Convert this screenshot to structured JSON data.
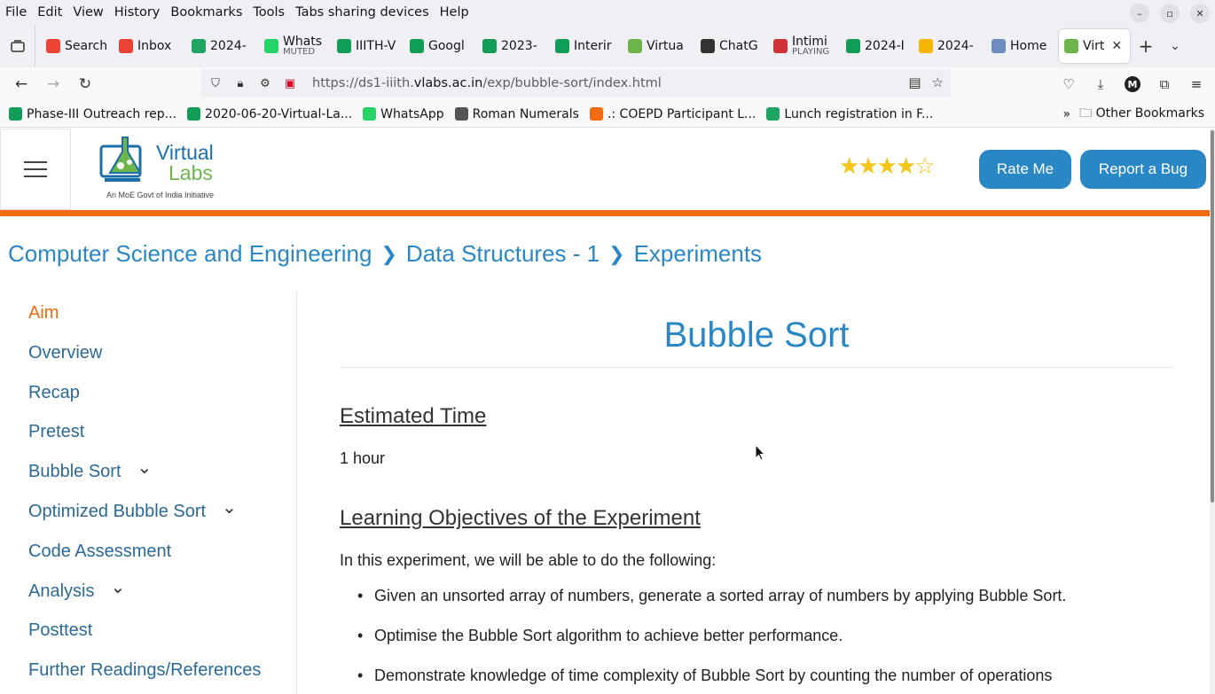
{
  "menubar": {
    "items": [
      "File",
      "Edit",
      "View",
      "History",
      "Bookmarks",
      "Tools",
      "Tabs sharing devices",
      "Help"
    ]
  },
  "tabs": [
    {
      "label": "Search",
      "fav": "gmail-icon",
      "color": "#ea4335"
    },
    {
      "label": "Inbox",
      "fav": "gmail-icon",
      "color": "#ea4335"
    },
    {
      "label": "2024-",
      "fav": "drive-icon",
      "color": "#1fa463"
    },
    {
      "label": "Whats",
      "sub": "MUTED",
      "fav": "whatsapp-icon",
      "color": "#25d366"
    },
    {
      "label": "IIITH-V",
      "fav": "sheets-icon",
      "color": "#0f9d58"
    },
    {
      "label": "Googl",
      "fav": "sheets-icon",
      "color": "#0f9d58"
    },
    {
      "label": "2023-",
      "fav": "sheets-icon",
      "color": "#0f9d58"
    },
    {
      "label": "Interir",
      "fav": "sheets-icon",
      "color": "#0f9d58"
    },
    {
      "label": "Virtua",
      "fav": "vlabs-icon",
      "color": "#6cb64b"
    },
    {
      "label": "ChatG",
      "fav": "chatgpt-icon",
      "color": "#333333"
    },
    {
      "label": "Intimi",
      "sub": "PLAYING",
      "fav": "podcast-icon",
      "color": "#d0323b"
    },
    {
      "label": "2024-I",
      "fav": "sheets-icon",
      "color": "#0f9d58"
    },
    {
      "label": "2024-",
      "fav": "slides-icon",
      "color": "#f4b400"
    },
    {
      "label": "Home",
      "fav": "home-icon",
      "color": "#6c8ebf"
    },
    {
      "label": "Virt",
      "fav": "vlabs-icon",
      "color": "#6cb64b",
      "active": true
    }
  ],
  "urlbar": {
    "prefix": "https://ds1-iiith.",
    "host": "vlabs.ac.in",
    "path": "/exp/bubble-sort/index.html"
  },
  "bookmarks": [
    {
      "label": "Phase-III Outreach rep...",
      "fav": "sheets-icon",
      "color": "#0f9d58"
    },
    {
      "label": "2020-06-20-Virtual-La...",
      "fav": "sheets-icon",
      "color": "#0f9d58"
    },
    {
      "label": "WhatsApp",
      "fav": "whatsapp-icon",
      "color": "#25d366"
    },
    {
      "label": "Roman Numerals",
      "fav": "roman-icon",
      "color": "#555555"
    },
    {
      "label": ".: COEPD Participant L...",
      "fav": "coepd-icon",
      "color": "#f26b0f"
    },
    {
      "label": "Lunch registration in F...",
      "fav": "drive-icon",
      "color": "#1fa463"
    }
  ],
  "bookmarks_other": "Other Bookmarks",
  "site": {
    "logo_line1": "Virtual",
    "logo_line2": "Labs",
    "logo_tagline": "An MoE Govt of India Initiative",
    "rating": 4,
    "rating_max": 5,
    "rate_button": "Rate Me",
    "bug_button": "Report a Bug"
  },
  "breadcrumb": [
    "Computer Science and Engineering",
    "Data Structures - 1",
    "Experiments"
  ],
  "sidebar": [
    {
      "label": "Aim",
      "active": true,
      "expandable": false
    },
    {
      "label": "Overview",
      "expandable": false
    },
    {
      "label": "Recap",
      "expandable": false
    },
    {
      "label": "Pretest",
      "expandable": false
    },
    {
      "label": "Bubble Sort",
      "expandable": true
    },
    {
      "label": "Optimized Bubble Sort",
      "expandable": true
    },
    {
      "label": "Code Assessment",
      "expandable": false
    },
    {
      "label": "Analysis",
      "expandable": true
    },
    {
      "label": "Posttest",
      "expandable": false
    },
    {
      "label": "Further Readings/References",
      "expandable": false
    }
  ],
  "content": {
    "title": "Bubble Sort",
    "section1_heading": "Estimated Time",
    "section1_text": "1 hour",
    "section2_heading": "Learning Objectives of the Experiment",
    "section2_intro": "In this experiment, we will be able to do the following:",
    "objectives": [
      "Given an unsorted array of numbers, generate a sorted array of numbers by applying Bubble Sort.",
      "Optimise the Bubble Sort algorithm to achieve better performance.",
      "Demonstrate knowledge of time complexity of Bubble Sort by counting the number of operations"
    ]
  },
  "colors": {
    "accent": "#2a87c6",
    "orange": "#f26b0f",
    "star": "#f5c518"
  }
}
